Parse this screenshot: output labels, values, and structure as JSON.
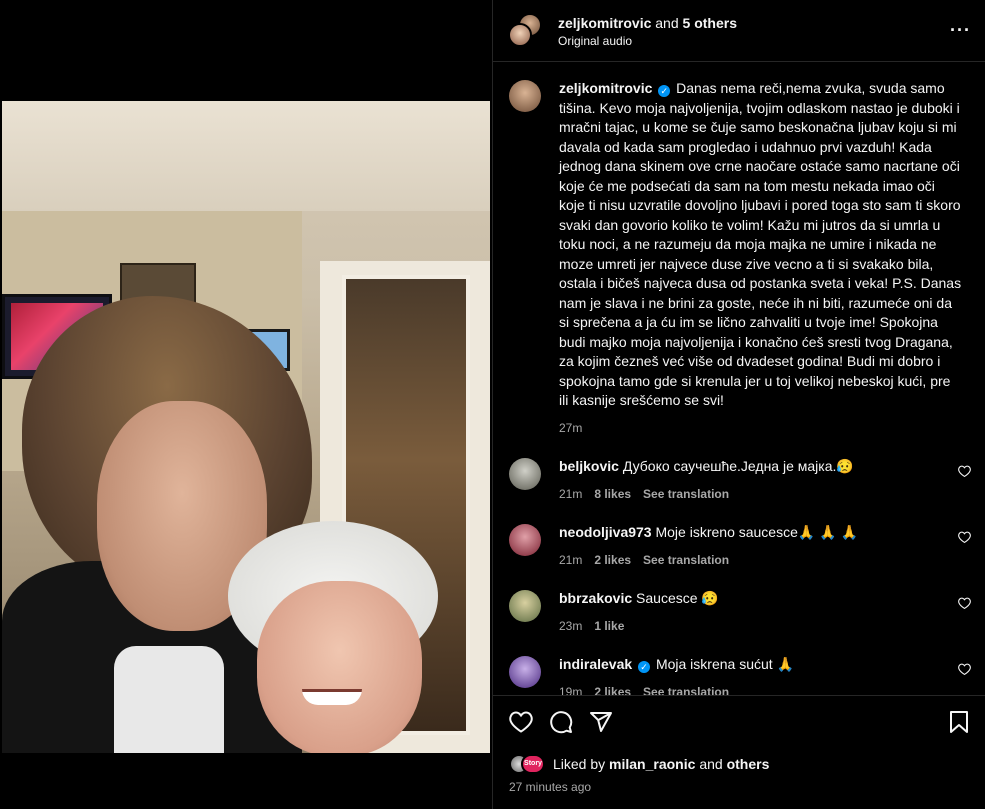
{
  "header": {
    "username": "zeljkomitrovic",
    "and_text": "and",
    "others": "5 others",
    "audio": "Original audio",
    "more_icon": "more-horizontal-icon"
  },
  "caption": {
    "username": "zeljkomitrovic",
    "verified": true,
    "text": "Danas nema reči,nema zvuka, svuda samo tišina. Kevo moja najvoljenija, tvojim odlaskom nastao je duboki i mračni tajac, u kome se čuje samo beskonačna ljubav koju si mi davala od kada sam progledao i udahnuo prvi vazduh! Kada jednog dana skinem ove crne naočare ostaće samo nacrtane oči koje će me podsećati da sam na tom mestu nekada imao oči koje ti nisu uzvratile dovoljno ljubavi i pored toga sto sam ti skoro svaki dan govorio koliko te volim! Kažu mi jutros da si umrla u toku noci, a ne razumeju da moja majka ne umire i nikada ne moze umreti jer najvece duse zive vecno a ti si svakako bila, ostala i bičeš najveca dusa od postanka sveta i veka! P.S. Danas nam je slava i ne brini za goste, neće ih ni biti, razumeće oni da si sprečena a ja ću im se lično zahvaliti u tvoje ime! Spokojna budi majko moja najvoljenija i konačno ćeš sresti tvog Dragana, za kojim čezneš već više od dvadeset godina! Budi mi dobro i spokojna tamo gde si krenula jer u toj velikoj nebeskoj kući, pre ili kasnije srešćemo se svi!",
    "time": "27m"
  },
  "comments": [
    {
      "username": "beljkovic",
      "verified": false,
      "text": "Дубоко саучешће.Једна је мајка.😥",
      "time": "21m",
      "likes": "8 likes",
      "translate": "See translation",
      "avatar_color": "#8a8a80"
    },
    {
      "username": "neodoljiva973",
      "verified": false,
      "text": "Moje iskreno saucesce🙏 🙏 🙏",
      "time": "21m",
      "likes": "2 likes",
      "translate": "See translation",
      "avatar_color": "#a0303a"
    },
    {
      "username": "bbrzakovic",
      "verified": false,
      "text": "Saucesce 😥",
      "time": "23m",
      "likes": "1 like",
      "translate": "",
      "avatar_color": "#7a8a60"
    },
    {
      "username": "indiralevak",
      "verified": true,
      "text": "Moja iskrena sućut 🙏",
      "time": "19m",
      "likes": "2 likes",
      "translate": "See translation",
      "avatar_color": "#6a4aa0"
    }
  ],
  "actions": {
    "like_icon": "heart-icon",
    "comment_icon": "comment-icon",
    "share_icon": "share-icon",
    "save_icon": "bookmark-icon"
  },
  "likes": {
    "prefix": "Liked by",
    "user": "milan_raonic",
    "suffix": "and",
    "others": "others",
    "story_badge": "Story"
  },
  "posted_ago": "27 minutes ago"
}
